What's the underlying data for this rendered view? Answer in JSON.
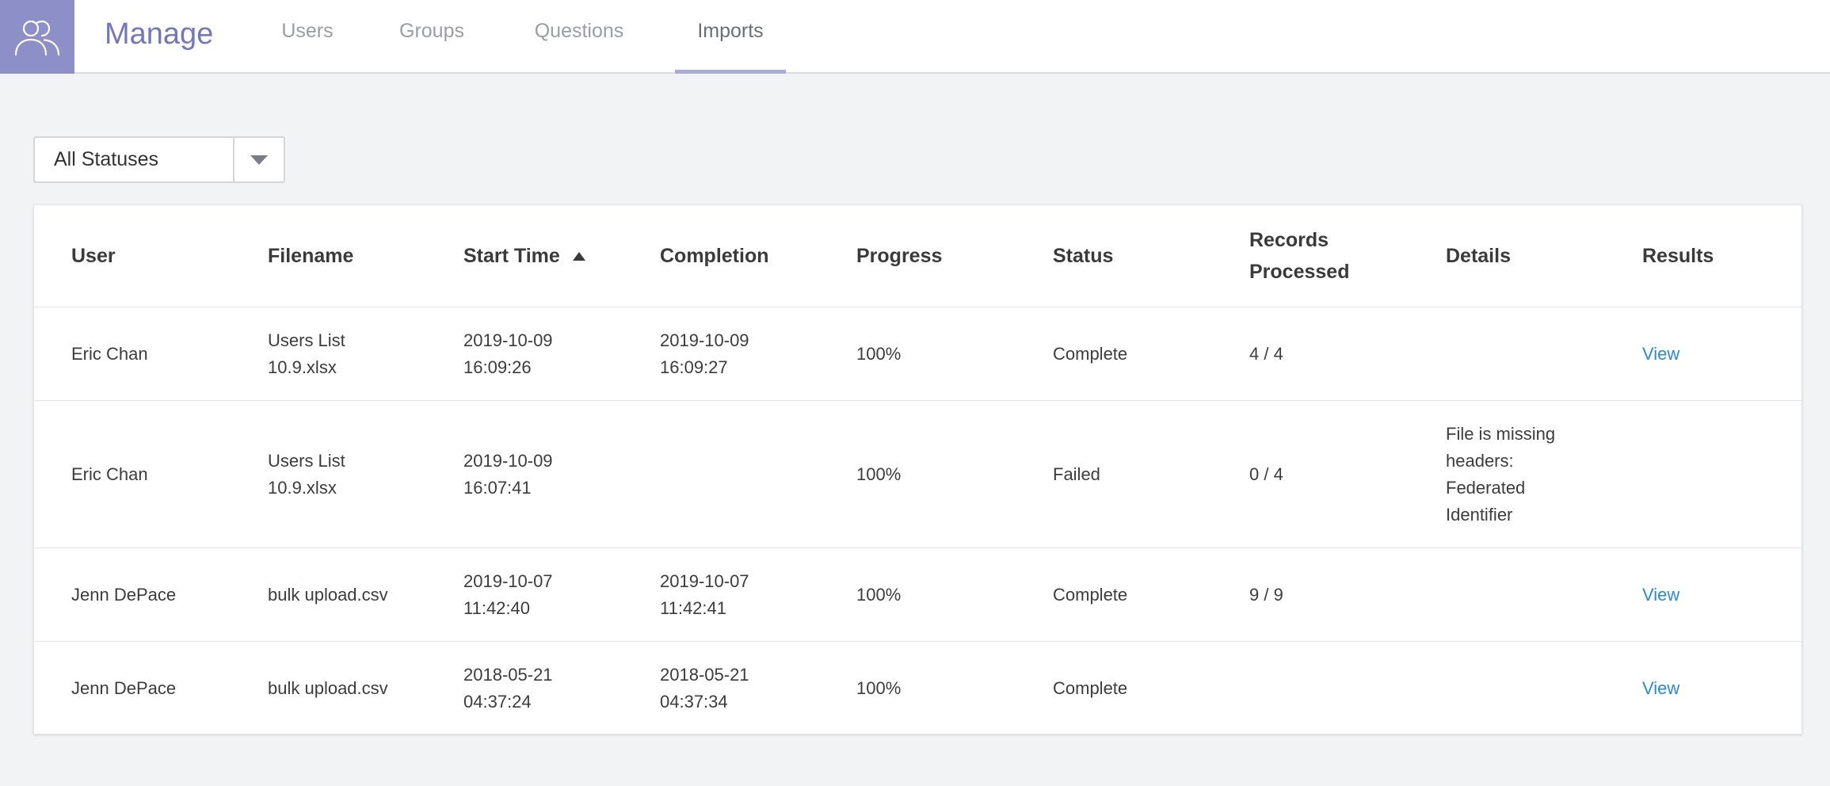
{
  "header": {
    "app_title": "Manage",
    "logo_icon": "users-group-icon",
    "tabs": [
      {
        "label": "Users"
      },
      {
        "label": "Groups"
      },
      {
        "label": "Questions"
      },
      {
        "label": "Imports",
        "active": true
      }
    ]
  },
  "filter": {
    "selected": "All Statuses",
    "toggle_icon": "caret-down-icon"
  },
  "table": {
    "columns": [
      {
        "label": "User"
      },
      {
        "label": "Filename"
      },
      {
        "label": "Start Time",
        "sort": "ascending"
      },
      {
        "label": "Completion"
      },
      {
        "label": "Progress"
      },
      {
        "label": "Status"
      },
      {
        "label": "Records\nProcessed"
      },
      {
        "label": "Details"
      },
      {
        "label": "Results"
      }
    ],
    "rows": [
      {
        "user": "Eric Chan",
        "filename": "Users List\n10.9.xlsx",
        "start_time": "2019-10-09\n16:09:26",
        "completion": "2019-10-09\n16:09:27",
        "progress": "100%",
        "status": "Complete",
        "records": "4 / 4",
        "details": "",
        "results": "View"
      },
      {
        "user": "Eric Chan",
        "filename": "Users List\n10.9.xlsx",
        "start_time": "2019-10-09\n16:07:41",
        "completion": "",
        "progress": "100%",
        "status": "Failed",
        "records": "0 / 4",
        "details": "File is missing\nheaders:\nFederated\nIdentifier",
        "results": ""
      },
      {
        "user": "Jenn DePace",
        "filename": "bulk upload.csv",
        "start_time": "2019-10-07\n11:42:40",
        "completion": "2019-10-07\n11:42:41",
        "progress": "100%",
        "status": "Complete",
        "records": "9 / 9",
        "details": "",
        "results": "View"
      },
      {
        "user": "Jenn DePace",
        "filename": "bulk upload.csv",
        "start_time": "2018-05-21\n04:37:24",
        "completion": "2018-05-21\n04:37:34",
        "progress": "100%",
        "status": "Complete",
        "records": "",
        "details": "",
        "results": "View"
      }
    ]
  },
  "colors": {
    "brand": "#8c8fc8",
    "title": "#7477ba",
    "link": "#2b8ad6",
    "active_tab_underline": "#a9abd6"
  }
}
